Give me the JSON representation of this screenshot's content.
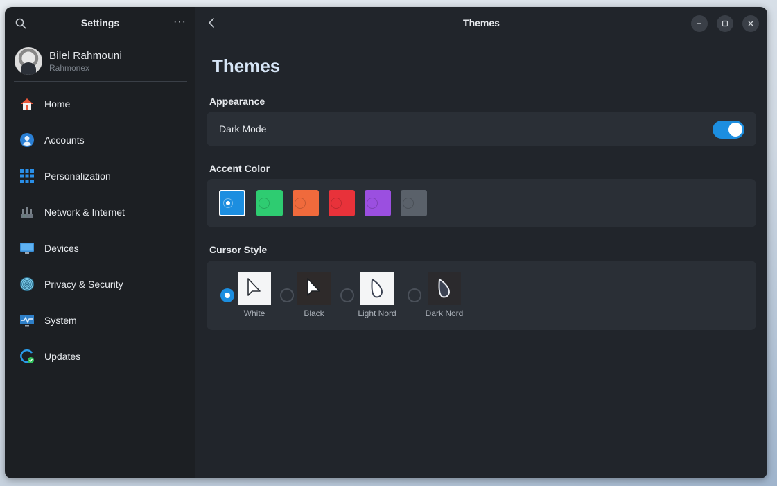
{
  "sidebar": {
    "title": "Settings",
    "more": "···",
    "profile": {
      "name": "Bilel Rahmouni",
      "username": "Rahmonex"
    },
    "items": [
      {
        "label": "Home",
        "icon": "home-icon"
      },
      {
        "label": "Accounts",
        "icon": "account-icon"
      },
      {
        "label": "Personalization",
        "icon": "grid-icon"
      },
      {
        "label": "Network & Internet",
        "icon": "network-icon"
      },
      {
        "label": "Devices",
        "icon": "monitor-icon"
      },
      {
        "label": "Privacy & Security",
        "icon": "fingerprint-icon"
      },
      {
        "label": "System",
        "icon": "system-icon"
      },
      {
        "label": "Updates",
        "icon": "update-icon"
      }
    ]
  },
  "header": {
    "title": "Themes"
  },
  "main": {
    "page_title": "Themes",
    "appearance": {
      "section": "Appearance",
      "dark_mode_label": "Dark Mode",
      "dark_mode_on": true
    },
    "accent": {
      "section": "Accent Color",
      "selected_index": 0,
      "colors": [
        "#1c8ee0",
        "#2ecc71",
        "#f06a3c",
        "#e8323a",
        "#9b4fe0",
        "#5a616a"
      ]
    },
    "cursor": {
      "section": "Cursor Style",
      "selected_index": 0,
      "options": [
        {
          "label": "White",
          "style": "white"
        },
        {
          "label": "Black",
          "style": "black"
        },
        {
          "label": "Light Nord",
          "style": "light-nord"
        },
        {
          "label": "Dark Nord",
          "style": "dark-nord"
        }
      ]
    }
  },
  "colors": {
    "accent": "#1c8ee0",
    "sidebar_bg": "#1c1f23",
    "main_bg": "#21252b",
    "card_bg": "#2a2f36",
    "page_title": "#d7e6f7"
  }
}
